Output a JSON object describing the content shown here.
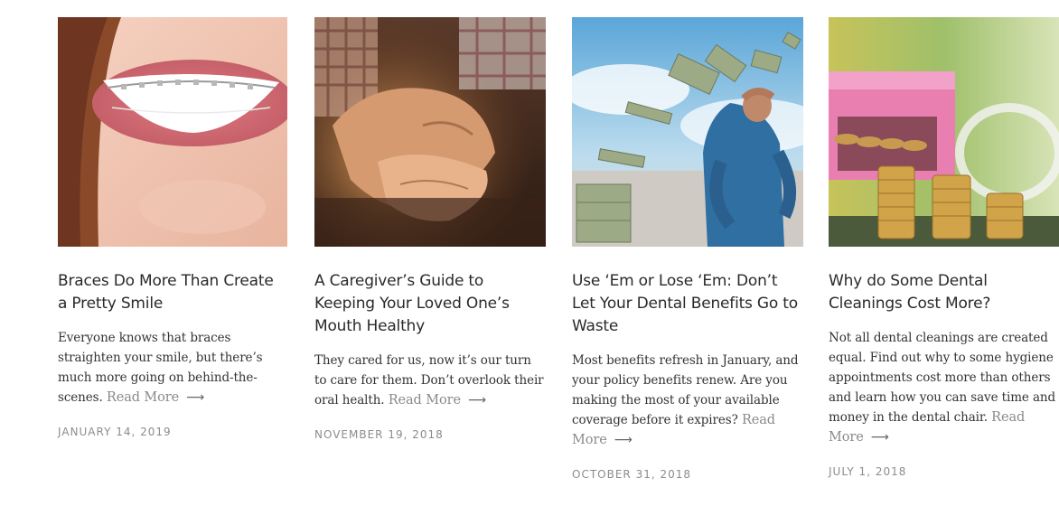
{
  "posts": [
    {
      "image": "teeth-with-braces-photo",
      "title": "Braces Do More Than Create a Pretty Smile",
      "excerpt": "Everyone knows that braces straighten your smile, but there’s much more going on behind-the-scenes.",
      "read_more": "Read More",
      "date": "JANUARY 14, 2019"
    },
    {
      "image": "holding-hands-photo",
      "title": "A Caregiver’s Guide to Keeping Your Loved One’s Mouth Healthy",
      "excerpt": "They cared for us, now it’s our turn to care for them. Don’t overlook their oral health.",
      "read_more": "Read More",
      "date": "NOVEMBER 19, 2018"
    },
    {
      "image": "flying-money-photo",
      "title": "Use ‘Em or Lose ‘Em: Don’t Let Your Dental Benefits Go to Waste",
      "excerpt": "Most benefits refresh in January, and your policy benefits renew. Are you making the most of your available coverage before it expires?",
      "read_more": "Read More",
      "date": "OCTOBER 31, 2018"
    },
    {
      "image": "coins-and-case-photo",
      "title": "Why do Some Dental Cleanings Cost More?",
      "excerpt": "Not all dental cleanings are created equal. Find out why to some hygiene appointments cost more than others and learn how you can save time and money in the dental chair.",
      "read_more": "Read More",
      "date": "JULY 1, 2018"
    }
  ],
  "arrow_glyph": "⟶"
}
